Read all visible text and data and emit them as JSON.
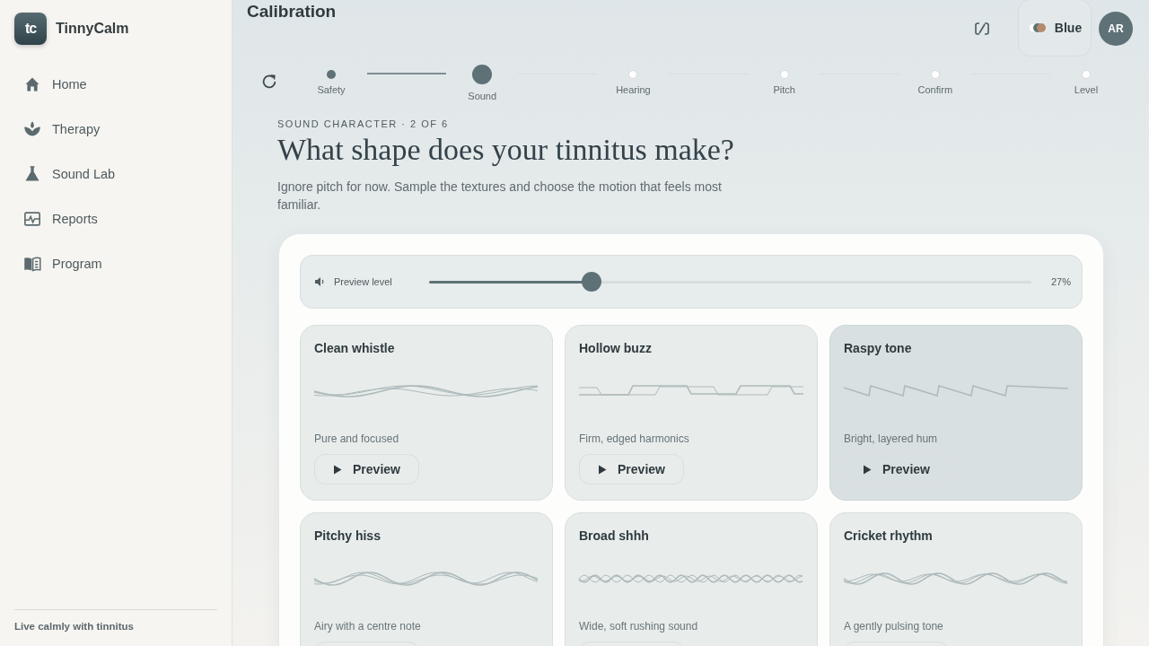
{
  "app": {
    "logo": "tc",
    "name": "TinnyCalm"
  },
  "nav": [
    {
      "label": "Home",
      "selected": false
    },
    {
      "label": "Therapy",
      "selected": false
    },
    {
      "label": "Sound Lab",
      "selected": false
    },
    {
      "label": "Reports",
      "selected": false
    },
    {
      "label": "Program",
      "selected": false
    }
  ],
  "sidebar_footer": "Live calmly with tinnitus",
  "page_title": "Calibration",
  "theme": {
    "label": "Blue"
  },
  "avatar": "AR",
  "steps": [
    {
      "label": "Safety",
      "done": true,
      "selected": false
    },
    {
      "label": "Sound",
      "done": false,
      "selected": true
    },
    {
      "label": "Hearing",
      "done": false,
      "selected": false
    },
    {
      "label": "Pitch",
      "done": false,
      "selected": false
    },
    {
      "label": "Confirm",
      "done": false,
      "selected": false
    },
    {
      "label": "Level",
      "done": false,
      "selected": false
    }
  ],
  "eyebrow": "SOUND CHARACTER · 2 OF 6",
  "heading": "What shape does your tinnitus make?",
  "intro": "Ignore pitch for now. Sample the textures and choose the motion that feels most familiar.",
  "preview": {
    "label": "Preview level",
    "level": 0.27,
    "reading": "27%"
  },
  "sounds": [
    {
      "name": "Clean whistle",
      "description": "Pure and focused",
      "button": "Preview",
      "selected": false
    },
    {
      "name": "Hollow buzz",
      "description": "Firm, edged harmonics",
      "button": "Preview",
      "selected": false
    },
    {
      "name": "Raspy tone",
      "description": "Bright, layered hum",
      "button": "Preview",
      "selected": true
    },
    {
      "name": "Pitchy hiss",
      "description": "Airy with a centre note",
      "selected": false
    },
    {
      "name": "Broad shhh",
      "description": "Wide, soft rushing sound",
      "selected": false
    },
    {
      "name": "Cricket rhythm",
      "description": "A gently pulsing tone",
      "selected": false
    }
  ]
}
